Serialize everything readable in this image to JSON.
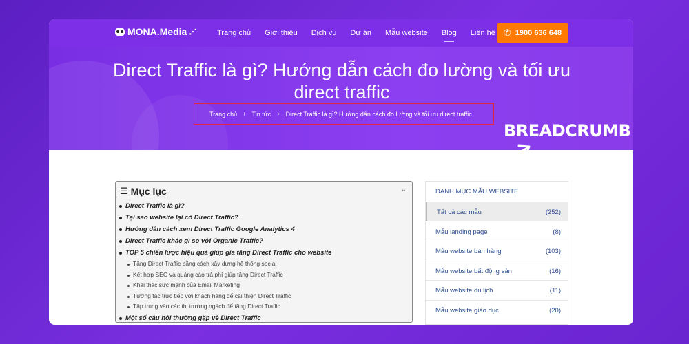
{
  "nav": {
    "logo": "MONA.Media",
    "items": [
      "Trang chủ",
      "Giới thiệu",
      "Dịch vụ",
      "Dự án",
      "Mẫu website",
      "Blog",
      "Liên hệ"
    ],
    "active": "Blog",
    "phone": "1900 636 648"
  },
  "hero": {
    "title": "Direct Traffic là gì? Hướng dẫn cách đo lường và tối ưu direct traffic",
    "breadcrumb": [
      "Trang chủ",
      "Tin tức",
      "Direct Traffic là gì? Hướng dẫn cách đo lường và tối ưu direct traffic"
    ],
    "callout": "BREADCRUMB"
  },
  "toc": {
    "title": "Mục lục",
    "items": [
      {
        "level": 1,
        "text": "Direct Traffic là gì?"
      },
      {
        "level": 1,
        "text": "Tại sao website lại có Direct Traffic?"
      },
      {
        "level": 1,
        "text": "Hướng dẫn cách xem Direct Traffic Google Analytics 4"
      },
      {
        "level": 1,
        "text": "Direct Traffic khác gì so với Organic Traffic?"
      },
      {
        "level": 1,
        "text": "TOP 5 chiến lược hiệu quả giúp gia tăng Direct Traffic cho website"
      },
      {
        "level": 2,
        "text": "Tăng Direct Traffic bằng cách xây dựng hệ thống social"
      },
      {
        "level": 2,
        "text": "Kết hợp SEO và quảng cáo trả phí giúp tăng Direct Traffic"
      },
      {
        "level": 2,
        "text": "Khai thác sức mạnh của Email Marketing"
      },
      {
        "level": 2,
        "text": "Tương tác trực tiếp với khách hàng để cải thiện Direct Traffic"
      },
      {
        "level": 2,
        "text": "Tập trung vào các thị trường ngách để tăng Direct Traffic"
      },
      {
        "level": 1,
        "text": "Một số câu hỏi thường gặp về Direct Traffic"
      }
    ]
  },
  "categories": {
    "title": "DANH MỤC MẪU WEBSITE",
    "items": [
      {
        "name": "Tất cả các mẫu",
        "count": "(252)",
        "selected": true
      },
      {
        "name": "Mẫu landing page",
        "count": "(8)"
      },
      {
        "name": "Mẫu website bán hàng",
        "count": "(103)"
      },
      {
        "name": "Mẫu website bất động sản",
        "count": "(16)"
      },
      {
        "name": "Mẫu website du lịch",
        "count": "(11)"
      },
      {
        "name": "Mẫu website giáo dục",
        "count": "(20)"
      }
    ]
  },
  "colors": {
    "accent": "#7c2fe6",
    "cta": "#ff7a00",
    "highlight_box": "#e0253c"
  }
}
